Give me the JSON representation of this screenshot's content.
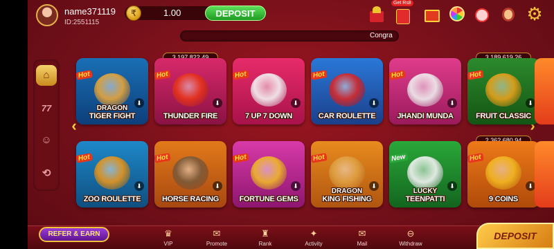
{
  "user": {
    "name": "name371119",
    "id": "ID:2551115"
  },
  "wallet": {
    "balance": "1.00",
    "deposit_label": "DEPOSIT"
  },
  "header_icons": [
    "gift-box-icon",
    "red-packet-icon",
    "gift-icon",
    "lucky-wheel-icon",
    "gift-bag-icon",
    "support-agent-icon",
    "gear-icon"
  ],
  "red_packet_badge": "Get Rs8",
  "marquee": "Congra",
  "sidebar": [
    {
      "name": "home",
      "glyph": "⌂",
      "active": true
    },
    {
      "name": "slots",
      "glyph": "77",
      "active": false
    },
    {
      "name": "people",
      "glyph": "☺",
      "active": false
    },
    {
      "name": "history",
      "glyph": "⟲",
      "active": false
    }
  ],
  "games_row1": [
    {
      "label_top": "DRAGON",
      "label": "TIGER  FIGHT",
      "badge": "Hot",
      "jackpot": "",
      "color": "#1a6fb5",
      "color2": "#0d3f7a",
      "art": "#e8a63a"
    },
    {
      "label_top": "",
      "label": "THUNDER FIRE",
      "badge": "Hot",
      "jackpot": "3,197,822.49",
      "color": "#d8296a",
      "color2": "#8a1244",
      "art": "#e8331a"
    },
    {
      "label_top": "",
      "label": "7 UP 7 DOWN",
      "badge": "Hot",
      "jackpot": "",
      "color": "#e72b6a",
      "color2": "#a8124a",
      "art": "#f4f4f4"
    },
    {
      "label_top": "",
      "label": "CAR ROULETTE",
      "badge": "Hot",
      "jackpot": "",
      "color": "#2a78d8",
      "color2": "#1b3f8a",
      "art": "#d8282a"
    },
    {
      "label_top": "",
      "label": "JHANDI MUNDA",
      "badge": "Hot",
      "jackpot": "",
      "color": "#e03c8c",
      "color2": "#9a1a5c",
      "art": "#f0f0f0"
    },
    {
      "label_top": "",
      "label": "FRUIT CLASSIC",
      "badge": "Hot",
      "jackpot": "3,189,619.26",
      "color": "#2c8a2c",
      "color2": "#145514",
      "art": "#e8a11a"
    }
  ],
  "games_row2": [
    {
      "label_top": "",
      "label": "ZOO ROULETTE",
      "badge": "Hot",
      "jackpot": "",
      "color": "#1e88c8",
      "color2": "#0f4f80",
      "art": "#e8951a"
    },
    {
      "label_top": "",
      "label": "HORSE RACING",
      "badge": "Hot",
      "jackpot": "",
      "color": "#e27a1a",
      "color2": "#a84810",
      "art": "#7a5a3a"
    },
    {
      "label_top": "",
      "label": "FORTUNE GEMS",
      "badge": "Hot",
      "jackpot": "",
      "color": "#d83aa8",
      "color2": "#8e1670",
      "art": "#f0b828"
    },
    {
      "label_top": "DRAGON",
      "label": "KING FISHING",
      "badge": "Hot",
      "jackpot": "",
      "color": "#e88b1e",
      "color2": "#b05510",
      "art": "#e0a040"
    },
    {
      "label_top": "LUCKY",
      "label": "TEENPATTI",
      "badge": "New",
      "jackpot": "",
      "color": "#2aa83a",
      "color2": "#13651e",
      "art": "#f4f4f4"
    },
    {
      "label_top": "",
      "label": "9 COINS",
      "badge": "Hot",
      "jackpot": "2,362,680.94",
      "color": "#ee7a18",
      "color2": "#b04a0a",
      "art": "#f2b822"
    }
  ],
  "bottom_nav": {
    "refer": "REFER & EARN",
    "items": [
      {
        "name": "vip",
        "label": "VIP",
        "glyph": "♛"
      },
      {
        "name": "promote",
        "label": "Promote",
        "glyph": "✉"
      },
      {
        "name": "rank",
        "label": "Rank",
        "glyph": "♜"
      },
      {
        "name": "activity",
        "label": "Activity",
        "glyph": "✦"
      },
      {
        "name": "mail",
        "label": "Mail",
        "glyph": "✉"
      },
      {
        "name": "withdraw",
        "label": "Withdraw",
        "glyph": "⊖"
      }
    ],
    "deposit": "DEPOSIT"
  },
  "colors": {
    "background": "#8a1420",
    "accent_gold": "#f2c23a",
    "deposit_green": "#2fb52f"
  }
}
